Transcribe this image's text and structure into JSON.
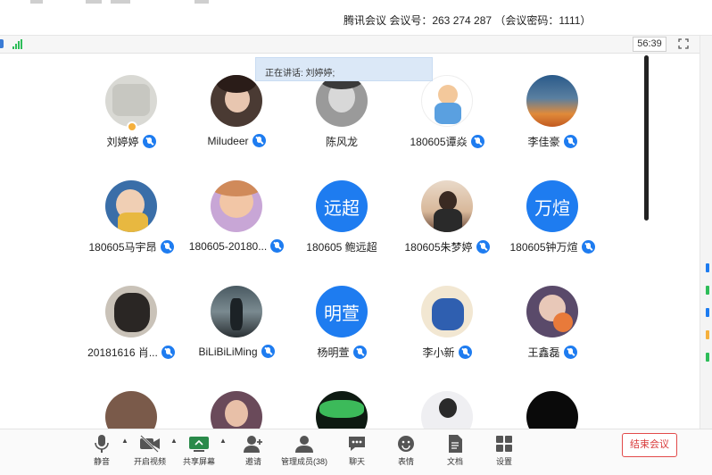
{
  "window": {
    "title": "腾讯会议 会议号：263 274 287 （会议密码：1111）"
  },
  "toolbar": {
    "timer": "56:39"
  },
  "speaking_banner": "正在讲话: 刘婷婷;",
  "participants": [
    {
      "name": "刘婷婷",
      "mic": "muted",
      "host": true
    },
    {
      "name": "Miludeer",
      "mic": "muted"
    },
    {
      "name": "陈风龙",
      "mic": "none"
    },
    {
      "name": "180605谭焱",
      "mic": "muted"
    },
    {
      "name": "李佳豪",
      "mic": "muted"
    },
    {
      "name": "180605马宇昂",
      "mic": "muted"
    },
    {
      "name": "180605-20180...",
      "mic": "muted"
    },
    {
      "name": "180605 鲍远超",
      "mic": "none",
      "avatar_text": "远超"
    },
    {
      "name": "180605朱梦婷",
      "mic": "muted"
    },
    {
      "name": "180605钟万煊",
      "mic": "muted",
      "avatar_text": "万煊"
    },
    {
      "name": "20181616 肖...",
      "mic": "muted"
    },
    {
      "name": "BiLiBiLiMing",
      "mic": "muted"
    },
    {
      "name": "杨明萱",
      "mic": "muted",
      "avatar_text": "明萱"
    },
    {
      "name": "李小新",
      "mic": "muted"
    },
    {
      "name": "王鑫磊",
      "mic": "muted"
    }
  ],
  "bottom_toolbar": {
    "mute": "静音",
    "start_video": "开启视频",
    "share_screen": "共享屏幕",
    "invite": "邀请",
    "manage_members": "管理成员(38)",
    "chat": "聊天",
    "reactions": "表情",
    "docs": "文档",
    "settings": "设置",
    "end_meeting": "结束会议"
  },
  "colors": {
    "accent": "#1e7cf0",
    "end_button": "#e24a4a",
    "signal": "#2ebd59",
    "banner_bg": "#dbe8f7"
  }
}
